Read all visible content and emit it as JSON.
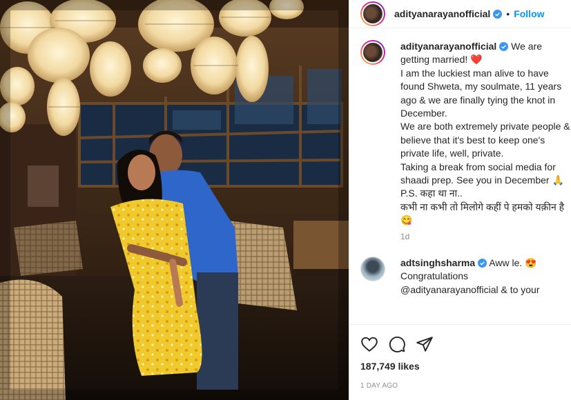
{
  "post": {
    "username": "adityanarayanofficial",
    "separator": "•",
    "follow_label": "Follow"
  },
  "caption": {
    "username": "adityanarayanofficial",
    "text": " We are getting married! ❤️\nI am the luckiest man alive to have found Shweta, my soulmate, 11 years ago & we are finally tying the knot in December.\nWe are both extremely private people & believe that it's best to keep one's private life, well, private.\nTaking a break from social media for shaadi prep. See you in December 🙏\nP.S. कहा था ना..\nकभी ना कभी तो मिलोगे कहीं पे हमको यक़ीन है 😋",
    "time": "1d"
  },
  "comment": {
    "username": "adtsinghsharma",
    "text": " Aww le. 😍\nCongratulations\n@adityanarayanofficial & to your"
  },
  "actions": {
    "likes": "187,749 likes",
    "posted": "1 DAY AGO"
  },
  "colors": {
    "accent": "#0095f6",
    "verified": "#3897f0",
    "muted": "#8e8e8e"
  },
  "icons": [
    "heart-icon",
    "comment-icon",
    "share-icon",
    "verified-badge-icon"
  ]
}
